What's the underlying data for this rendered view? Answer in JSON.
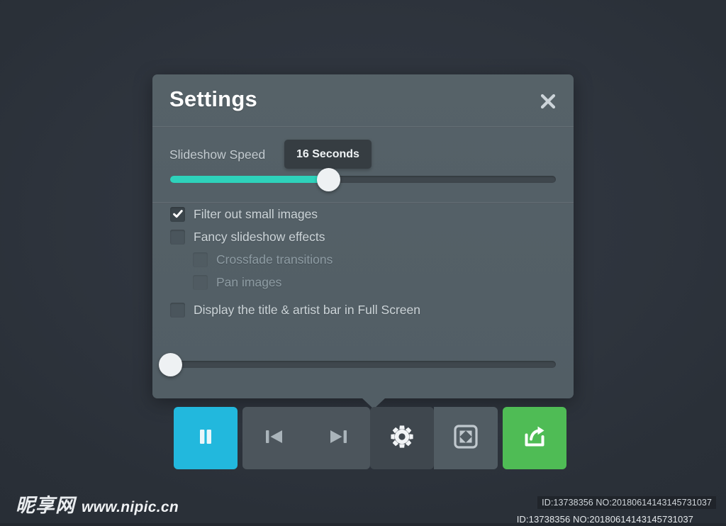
{
  "background": {
    "color": "#2e343d"
  },
  "panel": {
    "title": "Settings",
    "close_icon": "close-icon",
    "speed": {
      "label": "Slideshow Speed",
      "tooltip_value": "16 Seconds",
      "fill_percent": 41,
      "accent_color": "#2ed2bb",
      "track_color": "#3f474d"
    },
    "options": [
      {
        "label": "Filter out small images",
        "checked": true,
        "disabled": false,
        "indent": 0
      },
      {
        "label": "Fancy slideshow effects",
        "checked": false,
        "disabled": false,
        "indent": 0
      },
      {
        "label": "Crossfade transitions",
        "checked": false,
        "disabled": true,
        "indent": 1
      },
      {
        "label": "Pan images",
        "checked": false,
        "disabled": true,
        "indent": 1
      },
      {
        "label": "Display the title & artist bar in Full Screen",
        "checked": false,
        "disabled": false,
        "indent": 0
      }
    ],
    "brightness": {
      "fill_percent": 0,
      "value_position": "left"
    }
  },
  "toolbar": {
    "buttons": [
      {
        "name": "pause-button",
        "icon": "pause-icon",
        "color": "#22b8dd"
      },
      {
        "name": "previous-button",
        "icon": "skip-previous-icon",
        "color": "#4c555c"
      },
      {
        "name": "next-button",
        "icon": "skip-next-icon",
        "color": "#4c555c"
      },
      {
        "name": "settings-button",
        "icon": "gear-icon",
        "color": "#3f474e"
      },
      {
        "name": "fullscreen-button",
        "icon": "fullscreen-icon",
        "color": "#515c63"
      },
      {
        "name": "share-button",
        "icon": "share-icon",
        "color": "#4fbc55"
      }
    ]
  },
  "watermark": {
    "logo_text": "昵享网",
    "url": "www.nipic.cn",
    "id_primary": "ID:13738356 NO:20180614143145731037",
    "id_secondary": "ID:13738356 NO:20180614143145731037"
  }
}
